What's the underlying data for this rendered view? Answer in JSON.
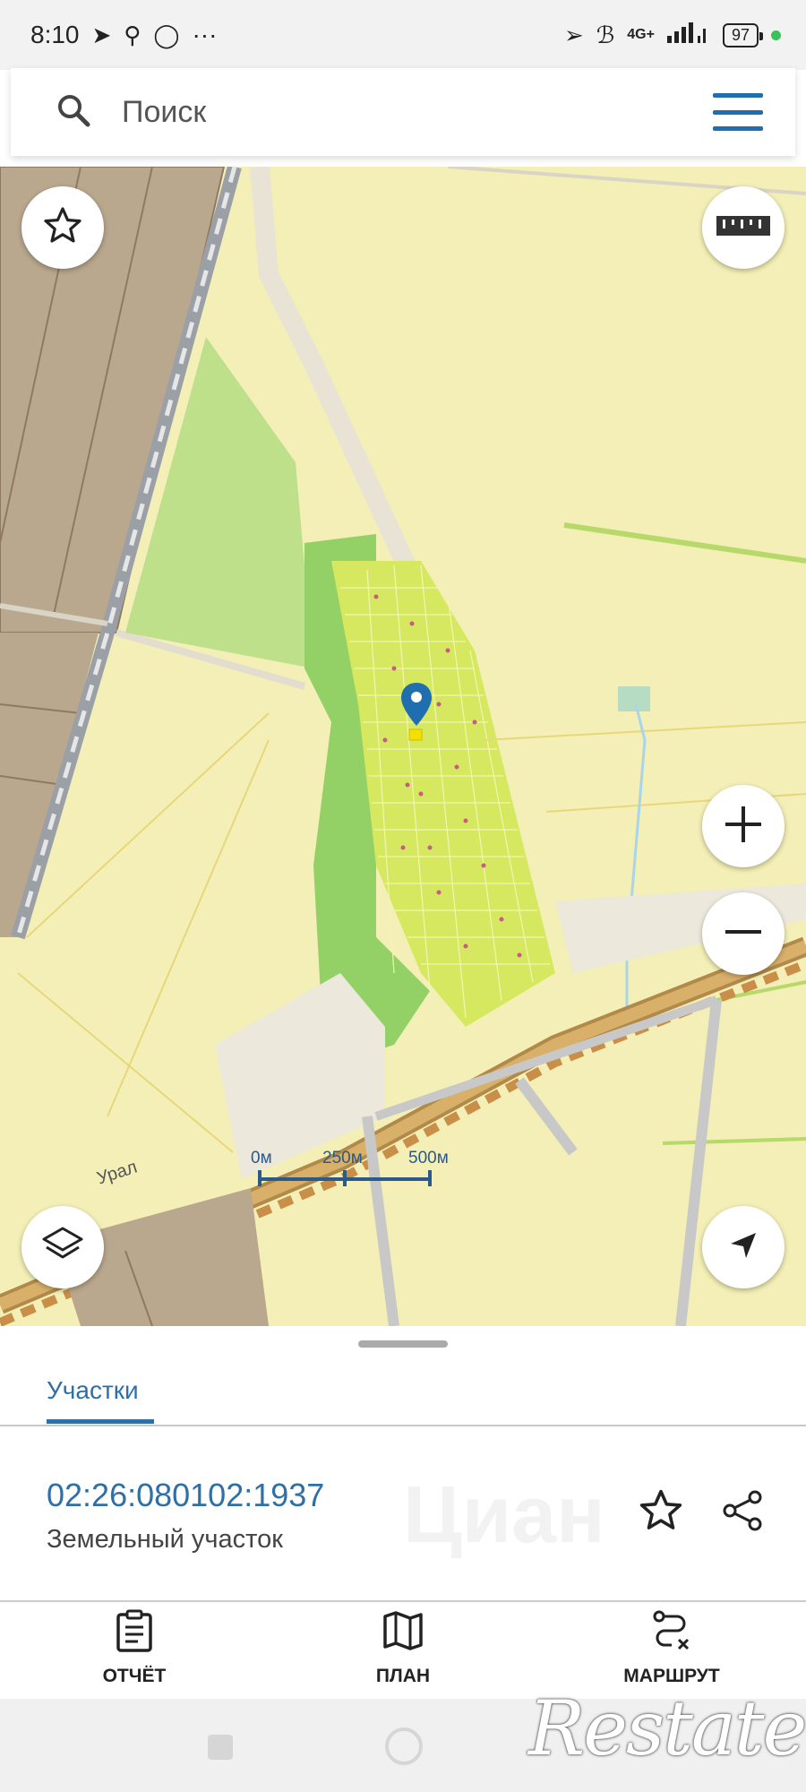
{
  "status_bar": {
    "time": "8:10",
    "more": "···",
    "network": "4G+",
    "battery": "97"
  },
  "search": {
    "placeholder": "Поиск"
  },
  "map": {
    "railway_label": "Урал",
    "scale": {
      "labels": [
        "0м",
        "250м",
        "500м"
      ]
    },
    "colors": {
      "land": "#f3efb6",
      "forest": "#9fd66a",
      "parcel": "#d6e860",
      "built": "#b9a78e",
      "road": "#c8a25a",
      "marker": "#1f6fb0"
    }
  },
  "sheet": {
    "tab_label": "Участки",
    "cadastral_number": "02:26:080102:1937",
    "parcel_type": "Земельный участок",
    "watermark": "Циан",
    "nav": [
      {
        "label": "ОТЧЁТ",
        "icon": "report-icon"
      },
      {
        "label": "ПЛАН",
        "icon": "map-plan-icon"
      },
      {
        "label": "МАРШРУТ",
        "icon": "route-icon"
      }
    ]
  },
  "brand_watermark": "Restate"
}
